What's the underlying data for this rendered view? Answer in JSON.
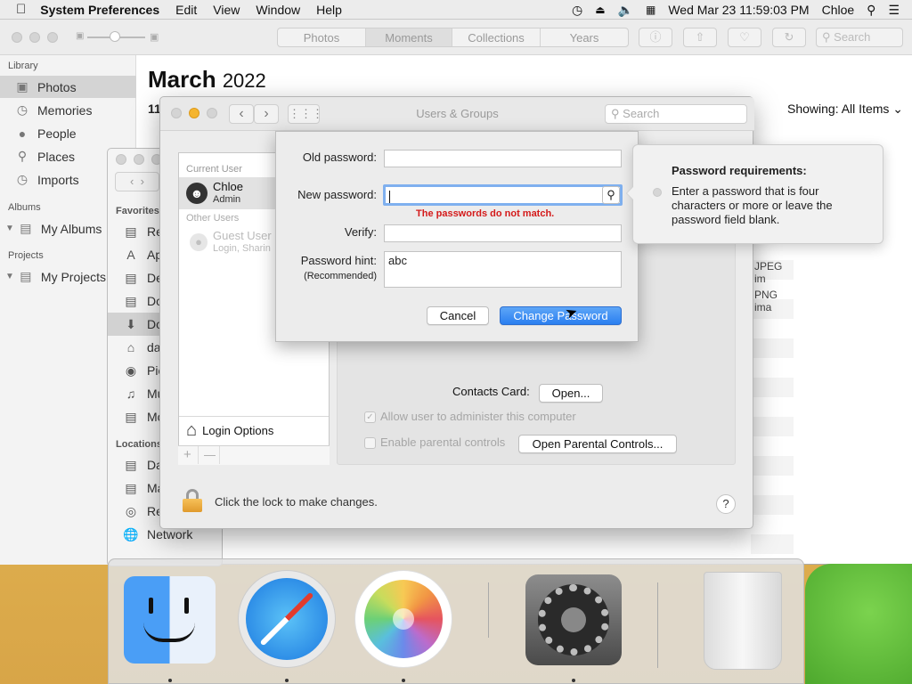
{
  "menubar": {
    "app_name": "System Preferences",
    "items": [
      "Edit",
      "View",
      "Window",
      "Help"
    ],
    "datetime": "Wed Mar 23  11:59:03 PM",
    "user": "Chloe"
  },
  "photos": {
    "tabs": [
      "Photos",
      "Moments",
      "Collections",
      "Years"
    ],
    "active_tab": "Moments",
    "search_placeholder": "Search",
    "heading_month": "March",
    "heading_year": "2022",
    "day_fragment": "11",
    "showing_label": "Showing:",
    "showing_value": "All Items",
    "sidebar": {
      "library_label": "Library",
      "library_items": [
        {
          "label": "Photos",
          "icon": "photos-icon"
        },
        {
          "label": "Memories",
          "icon": "memories-icon"
        },
        {
          "label": "People",
          "icon": "people-icon"
        },
        {
          "label": "Places",
          "icon": "places-icon"
        },
        {
          "label": "Imports",
          "icon": "imports-icon"
        }
      ],
      "albums_label": "Albums",
      "albums_item": "My Albums",
      "projects_label": "Projects",
      "projects_item": "My Projects"
    },
    "file_fragments": [
      "JPEG im",
      "PNG ima"
    ]
  },
  "finder": {
    "favorites_label": "Favorites",
    "favorites": [
      "Re",
      "Ap",
      "De",
      "Do",
      "Do",
      "da",
      "Pic",
      "Mu",
      "Mo"
    ],
    "locations_label": "Locations",
    "locations": [
      "Da",
      "Ma",
      "Re",
      "Network"
    ]
  },
  "users_groups": {
    "title": "Users & Groups",
    "search_placeholder": "Search",
    "current_user_label": "Current User",
    "current_user_name": "Chloe",
    "current_user_role": "Admin",
    "other_users_label": "Other Users",
    "guest_name": "Guest User",
    "guest_detail": "Login, Sharin",
    "login_options": "Login Options",
    "add_label": "+",
    "remove_label": "—",
    "contacts_card_label": "Contacts Card:",
    "open_button": "Open...",
    "allow_admin_label": "Allow user to administer this computer",
    "parental_label": "Enable parental controls",
    "open_parental_button": "Open Parental Controls...",
    "lock_text": "Click the lock to make changes.",
    "help_label": "?"
  },
  "sheet": {
    "old_password_label": "Old password:",
    "old_password_value": "",
    "new_password_label": "New password:",
    "new_password_value": "",
    "error_text": "The passwords do not match.",
    "verify_label": "Verify:",
    "verify_value": "",
    "hint_label": "Password hint:",
    "hint_sublabel": "(Recommended)",
    "hint_value": "abc",
    "cancel_button": "Cancel",
    "change_button": "Change Password"
  },
  "popover": {
    "title": "Password requirements:",
    "text": "Enter a password that is four characters or more or leave the password field blank."
  },
  "dock": {
    "apps": [
      "finder-icon",
      "safari-icon",
      "photos-app-icon",
      "system-preferences-icon",
      "trash-icon"
    ]
  }
}
